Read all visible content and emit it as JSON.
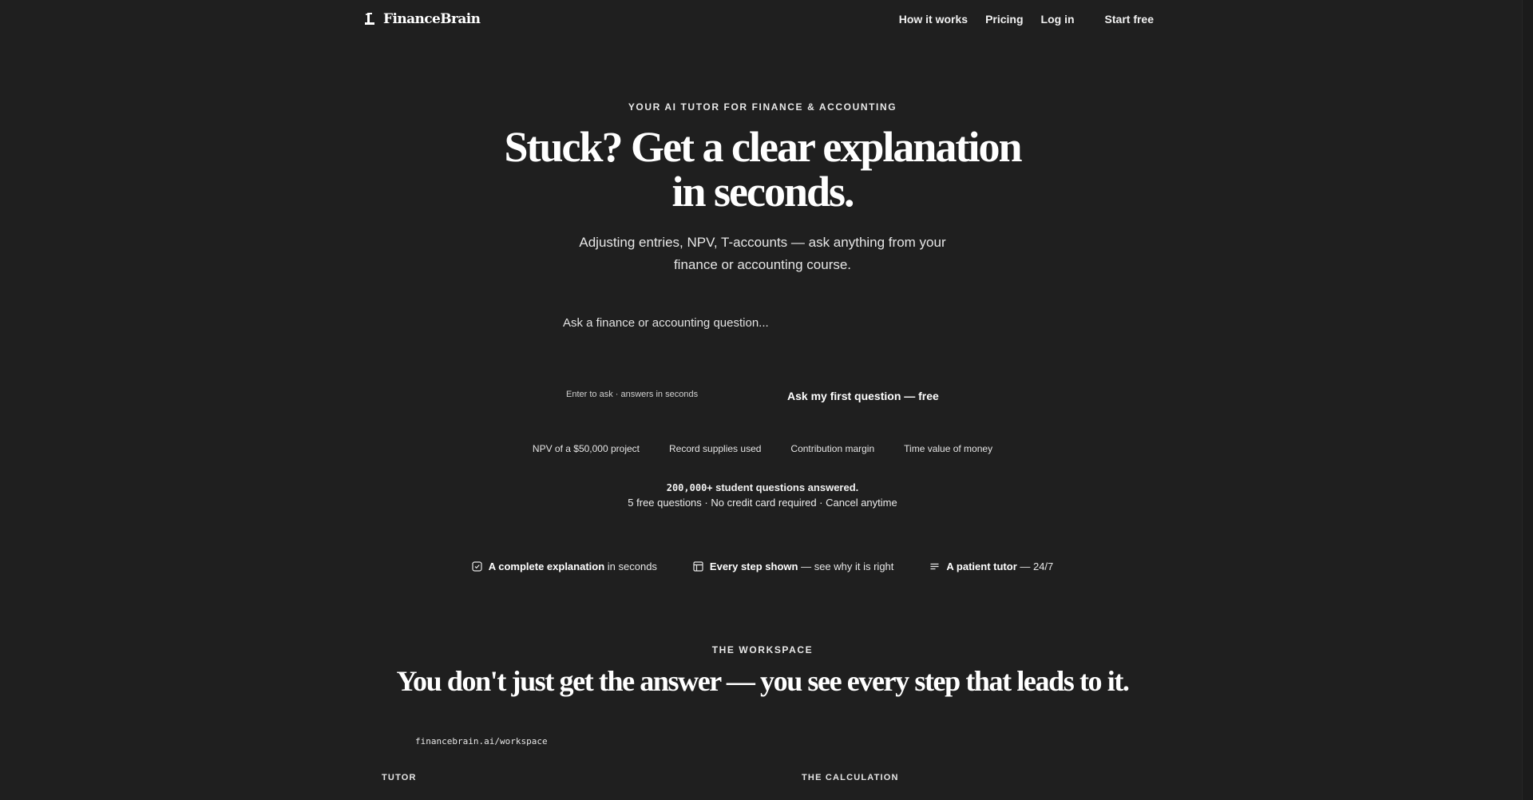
{
  "nav": {
    "brand": "FinanceBrain",
    "links": [
      "How it works",
      "Pricing",
      "Log in"
    ],
    "cta": "Start free"
  },
  "hero": {
    "eyebrow": "YOUR AI TUTOR FOR FINANCE & ACCOUNTING",
    "title": "Stuck? Get a clear explanation in seconds.",
    "subtitle": "Adjusting entries, NPV, T-accounts — ask anything from your finance or accounting course."
  },
  "ask": {
    "placeholder": "Ask a finance or accounting question...",
    "value": "",
    "hint": "Enter to ask · answers in seconds",
    "button": "Ask my first question — free"
  },
  "suggestions": [
    "NPV of a $50,000 project",
    "Record supplies used",
    "Contribution margin",
    "Time value of money"
  ],
  "proof": {
    "count": "200,000+",
    "line1_rest": " student questions answered.",
    "line2": "5 free questions · No credit card required · Cancel anytime"
  },
  "features": [
    {
      "icon": "check-square-icon",
      "strong": "A complete explanation",
      "rest": " in seconds"
    },
    {
      "icon": "table-icon",
      "strong": "Every step shown",
      "rest": " — see why it is right"
    },
    {
      "icon": "lines-icon",
      "strong": "A patient tutor",
      "rest": " — 24/7"
    }
  ],
  "workspace": {
    "eyebrow": "THE WORKSPACE",
    "title": "You don't just get the answer — you see every step that leads to it.",
    "url": "financebrain.ai/workspace",
    "left_label": "TUTOR",
    "right_label": "THE CALCULATION"
  },
  "colors": {
    "background": "#1f1f1f",
    "text": "#f2f2f2"
  }
}
